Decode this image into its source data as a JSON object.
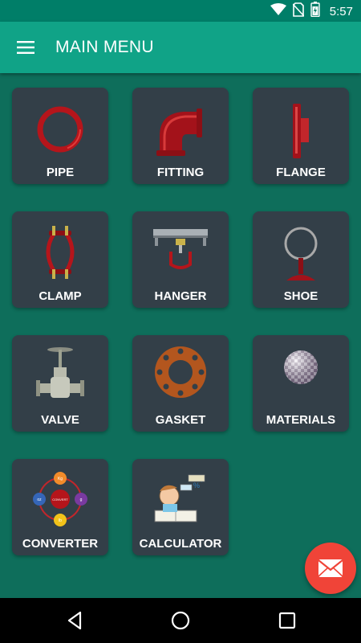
{
  "status_bar": {
    "time": "5:57"
  },
  "app_bar": {
    "title": "MAIN MENU",
    "menu_icon": "hamburger-menu-icon"
  },
  "tiles": [
    {
      "label": "PIPE",
      "icon": "pipe-icon"
    },
    {
      "label": "FITTING",
      "icon": "elbow-fitting-icon"
    },
    {
      "label": "FLANGE",
      "icon": "flange-icon"
    },
    {
      "label": "CLAMP",
      "icon": "clamp-icon"
    },
    {
      "label": "HANGER",
      "icon": "hanger-icon"
    },
    {
      "label": "SHOE",
      "icon": "pipe-shoe-icon"
    },
    {
      "label": "VALVE",
      "icon": "valve-icon"
    },
    {
      "label": "GASKET",
      "icon": "gasket-icon"
    },
    {
      "label": "MATERIALS",
      "icon": "materials-sphere-icon"
    },
    {
      "label": "CONVERTER",
      "icon": "converter-icon"
    },
    {
      "label": "CALCULATOR",
      "icon": "calculator-icon"
    }
  ],
  "converter_icon_text": {
    "center": "CONVERT",
    "top": "Kg",
    "right": "g",
    "bottom": "lb",
    "left": "oz"
  },
  "fab": {
    "icon": "email-icon"
  },
  "nav_bar": {
    "back": "back-icon",
    "home": "home-icon",
    "recents": "recents-icon"
  },
  "colors": {
    "background": "#0e6e5b",
    "app_bar": "#10a387",
    "status_bar": "#007e68",
    "tile": "#333f48",
    "fab": "#f04438",
    "accent_red": "#b5151b"
  }
}
